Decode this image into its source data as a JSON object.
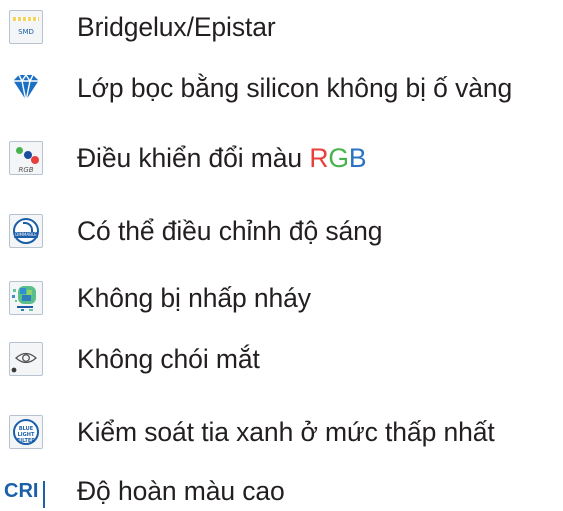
{
  "features": [
    {
      "icon": "smd-led-icon",
      "icon_text": "SMD",
      "label": "Bridgelux/Epistar"
    },
    {
      "icon": "diamond-icon",
      "label": "Lớp bọc bằng silicon không bị ố vàng"
    },
    {
      "icon": "rgb-dots-icon",
      "icon_text": "RGB",
      "label": "Điều khiển đổi màu ",
      "rgb": {
        "r": "R",
        "g": "G",
        "b": "B"
      }
    },
    {
      "icon": "dimmable-icon",
      "icon_text": "DIMMABLE",
      "label": "Có thể điều chỉnh độ sáng"
    },
    {
      "icon": "flicker-free-icon",
      "label": "Không bị nhấp nháy"
    },
    {
      "icon": "eye-icon",
      "label": "Không chói mắt"
    },
    {
      "icon": "blue-light-filter-icon",
      "icon_text": "BLUE LIGHT FILTER",
      "label": "Kiểm soát tia xanh ở mức thấp nhất"
    },
    {
      "icon": "cri-icon",
      "icon_text": "CRI",
      "label": "Độ hoàn màu cao"
    }
  ],
  "colors": {
    "text": "#231f20",
    "red": "#e8403b",
    "green": "#47b34b",
    "blue": "#2a73c4",
    "icon_blue": "#1b5fa8"
  }
}
